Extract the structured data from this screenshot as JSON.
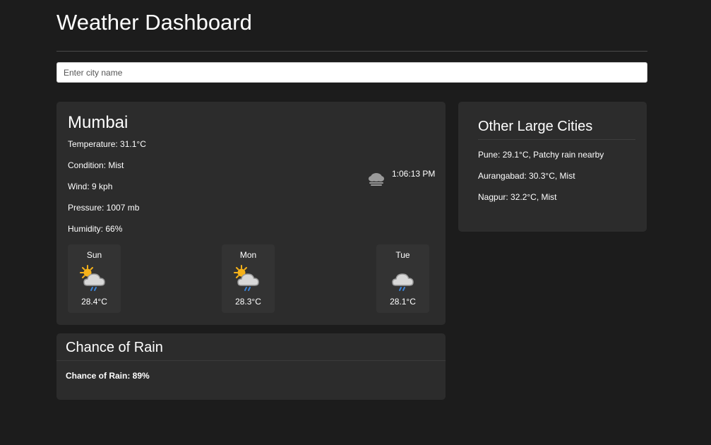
{
  "header": {
    "title": "Weather Dashboard"
  },
  "search": {
    "placeholder": "Enter city name",
    "value": ""
  },
  "current": {
    "city": "Mumbai",
    "temperature": "Temperature: 31.1°C",
    "condition": "Condition: Mist",
    "wind": "Wind: 9 kph",
    "pressure": "Pressure: 1007 mb",
    "humidity": "Humidity: 66%",
    "time": "1:06:13 PM",
    "icon": "mist-cloud-icon"
  },
  "forecast": [
    {
      "day": "Sun",
      "temp": "28.4°C",
      "icon": "patchy-rain-icon"
    },
    {
      "day": "Mon",
      "temp": "28.3°C",
      "icon": "patchy-rain-icon"
    },
    {
      "day": "Tue",
      "temp": "28.1°C",
      "icon": "light-rain-icon"
    }
  ],
  "rain": {
    "title": "Chance of Rain",
    "text": "Chance of Rain: 89%"
  },
  "other_cities": {
    "title": "Other Large Cities",
    "items": [
      "Pune: 29.1°C, Patchy rain nearby",
      "Aurangabad: 30.3°C, Mist",
      "Nagpur: 32.2°C, Mist"
    ]
  },
  "colors": {
    "background": "#1c1c1c",
    "card": "#2c2c2c",
    "forecast_tile": "#333333",
    "text": "#ffffff",
    "sun": "#f6b21a",
    "rain_drop": "#3b82d6"
  }
}
